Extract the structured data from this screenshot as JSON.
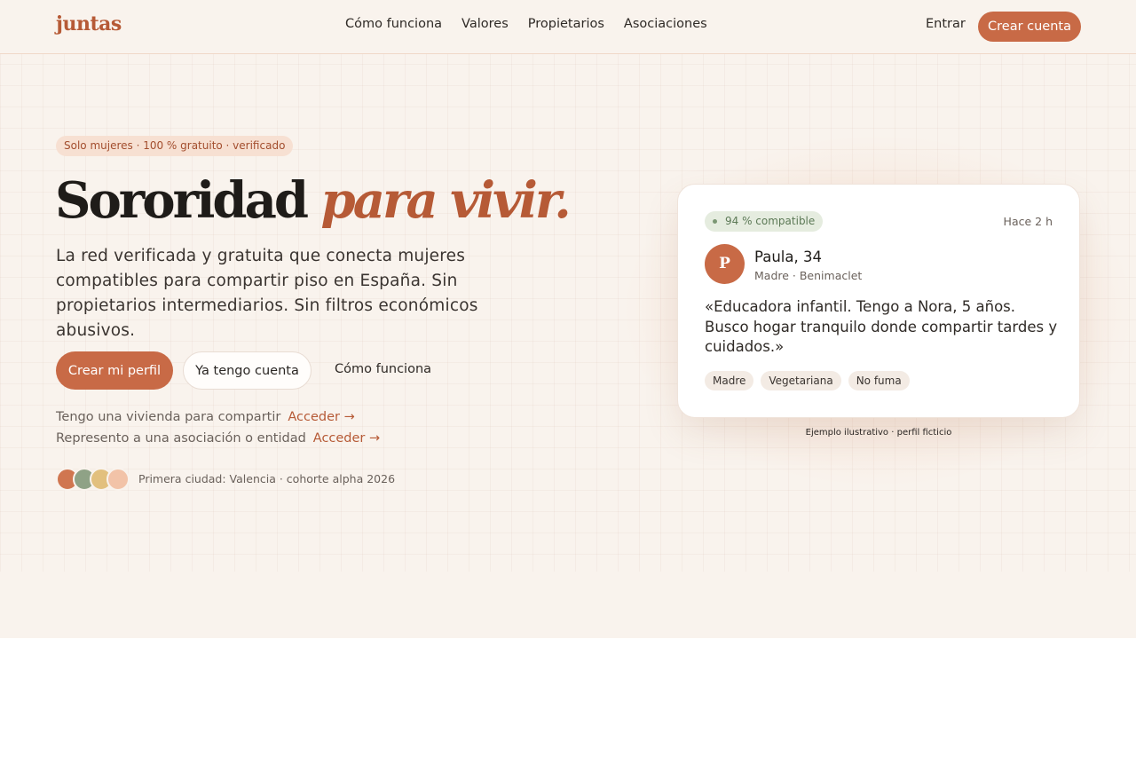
{
  "brand": {
    "logo": "juntas",
    "accent": "#c86a46"
  },
  "nav": {
    "links": [
      "Cómo funciona",
      "Valores",
      "Propietarios",
      "Asociaciones"
    ],
    "login": "Entrar",
    "cta": "Crear cuenta"
  },
  "hero": {
    "pill": "Solo mujeres · 100 % gratuito · verificado",
    "headline_plain": "Sororidad",
    "headline_accent": "para vivir.",
    "lead": "La red verificada y gratuita que conecta mujeres compatibles para compartir piso en España. Sin propietarios intermediarios. Sin filtros económicos abusivos.",
    "primary_button": "Crear mi perfil",
    "secondary_button": "Ya tengo cuenta",
    "link_button": "Cómo funciona",
    "owner_text": "Tengo una vivienda para compartir",
    "owner_link": "Acceder →",
    "association_text": "Represento a una asociación o entidad",
    "association_link": "Acceder →",
    "avatar_colors": [
      "#d07650",
      "#8fa286",
      "#e2c07e",
      "#f2c3a8"
    ],
    "cohort": "Primera ciudad: Valencia · cohorte alpha 2026"
  },
  "card": {
    "compatibility": "94 % compatible",
    "time": "Hace 2 h",
    "avatar_initial": "P",
    "name": "Paula, 34",
    "meta": "Madre · Benimaclet",
    "quote": "«Educadora infantil. Tengo a Nora, 5 años. Busco hogar tranquilo donde compartir tardes y cuidados.»",
    "tags": [
      "Madre",
      "Vegetariana",
      "No fuma"
    ],
    "caption": "Ejemplo ilustrativo · perfil ficticio"
  }
}
